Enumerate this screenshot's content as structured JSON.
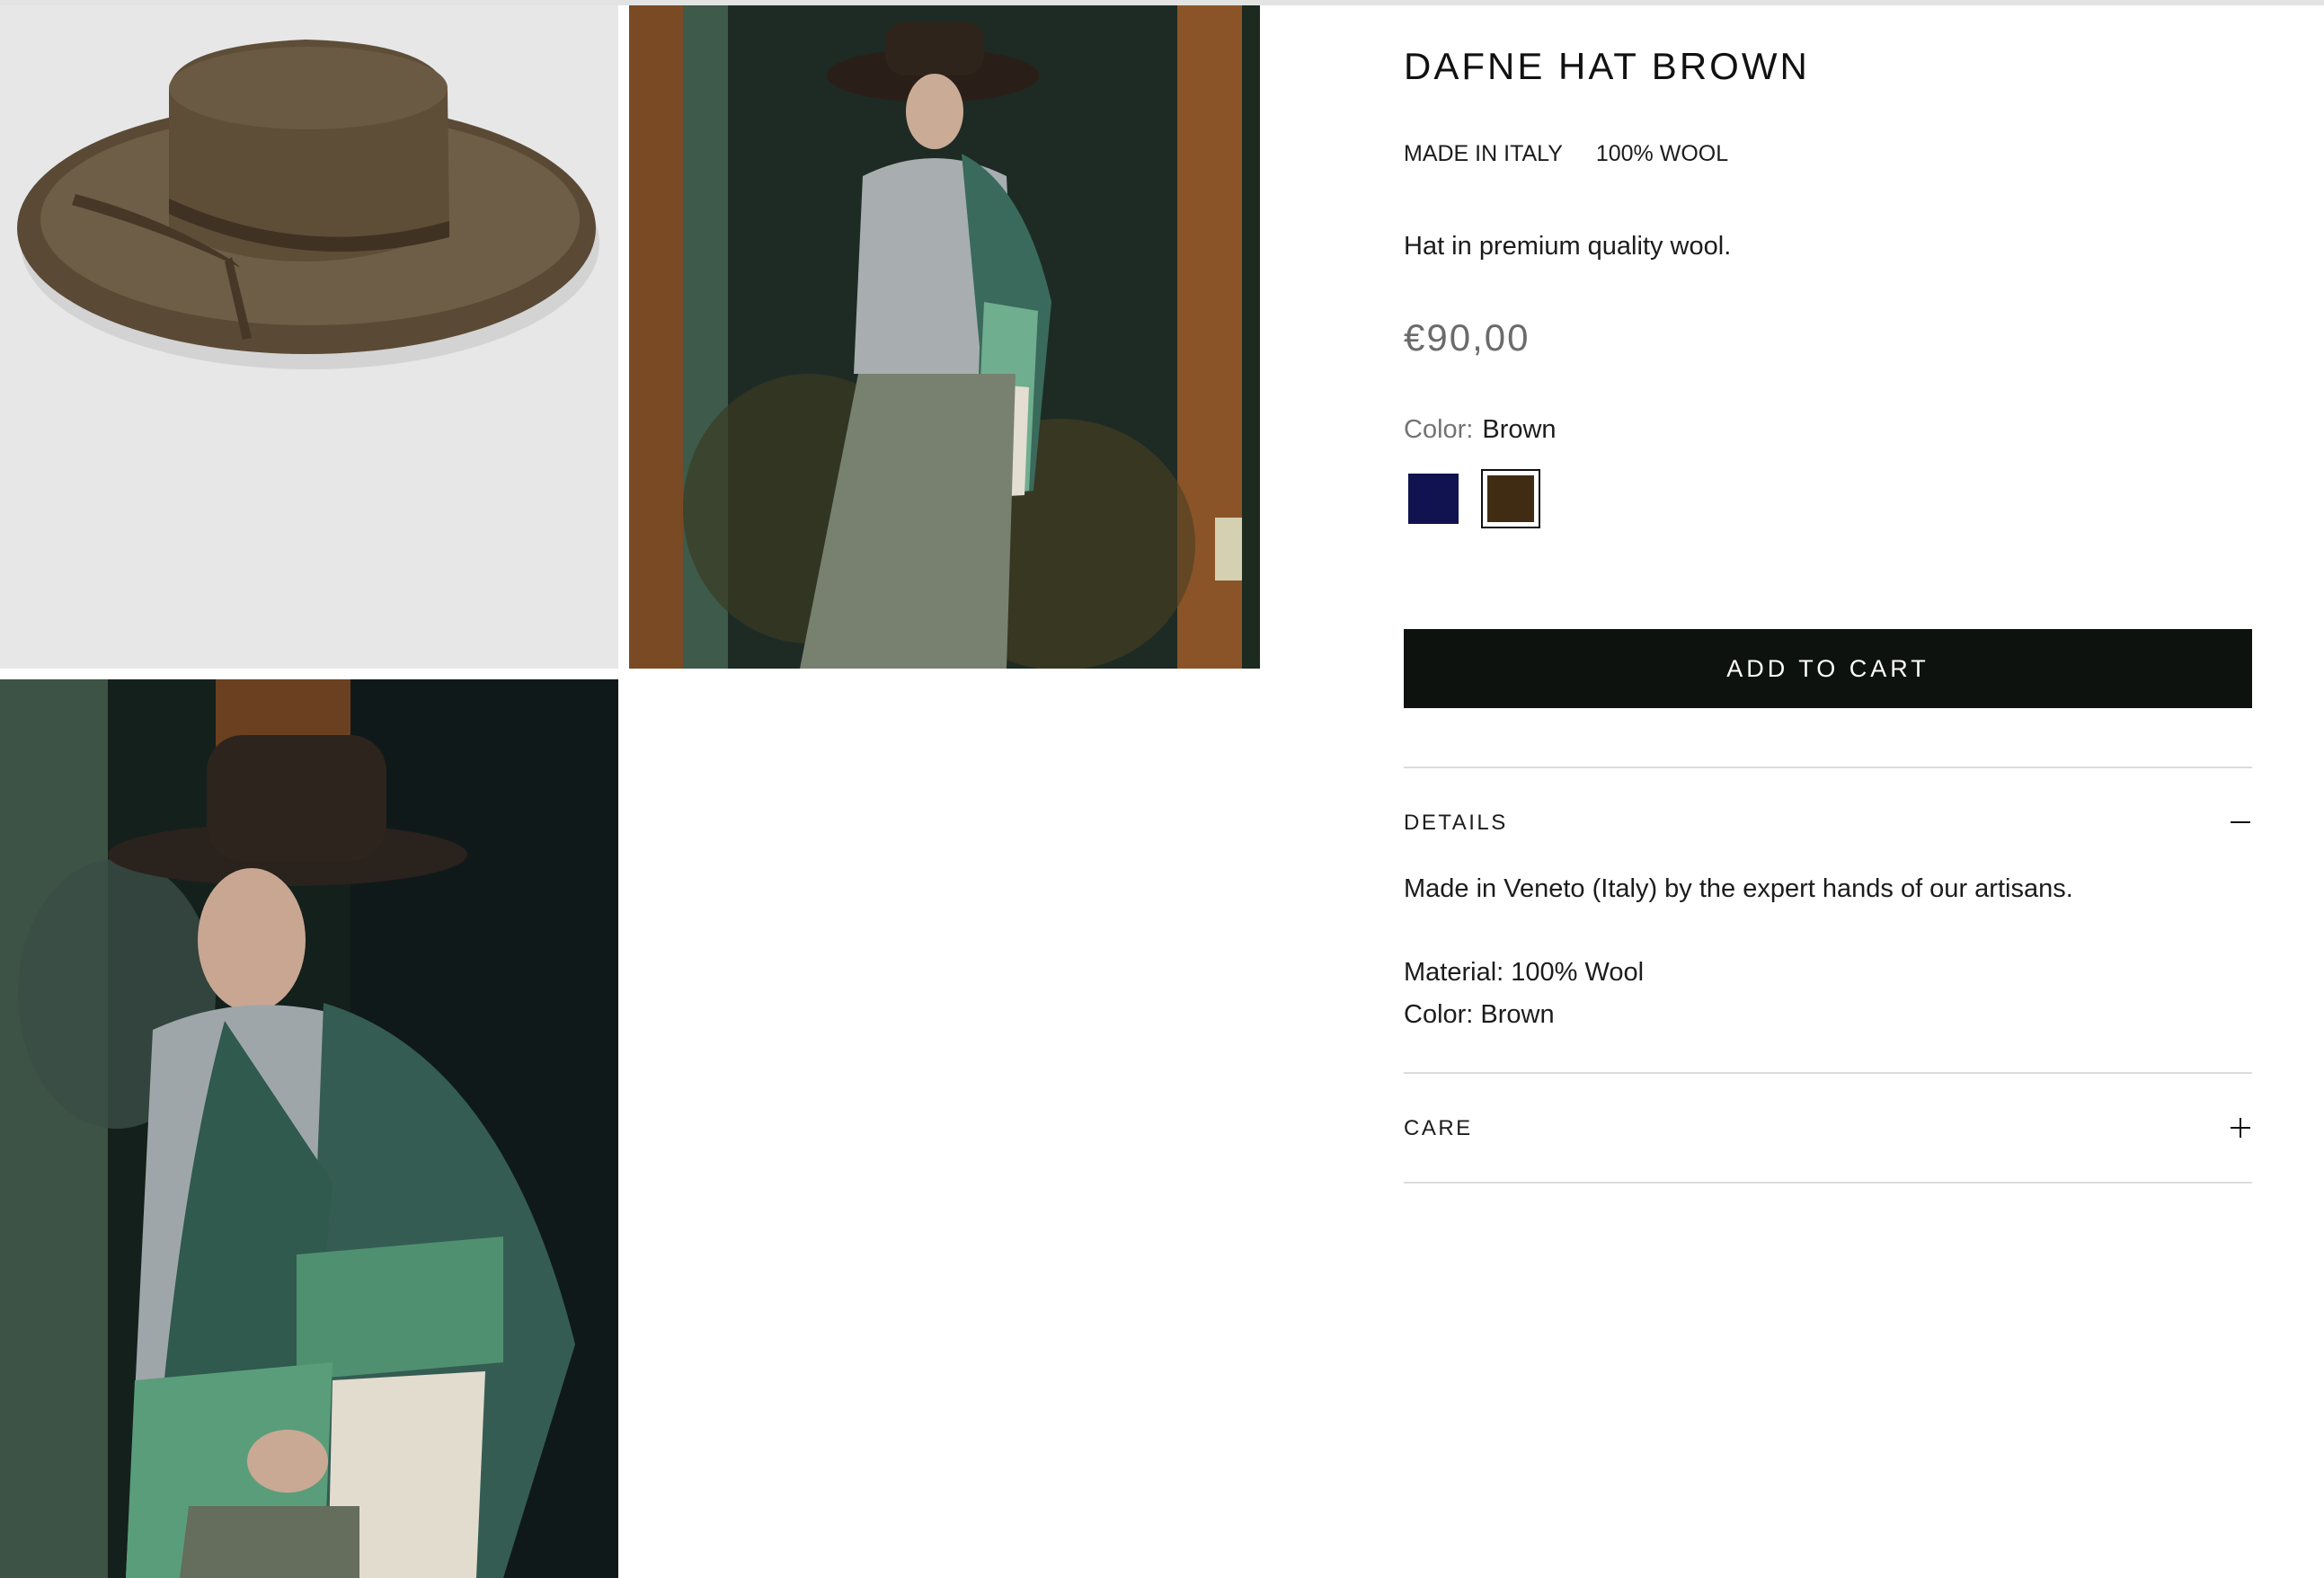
{
  "product": {
    "title": "DAFNE HAT BROWN",
    "tags": [
      "MADE IN ITALY",
      "100% WOOL"
    ],
    "description": "Hat in premium quality wool.",
    "price": "€90,00",
    "color_label": "Color:",
    "color_value": "Brown",
    "swatches": [
      {
        "name": "Navy",
        "hex": "#10134f",
        "selected": false
      },
      {
        "name": "Brown",
        "hex": "#3f2c12",
        "selected": true
      }
    ],
    "add_to_cart": "ADD TO CART"
  },
  "accordion": {
    "details": {
      "title": "DETAILS",
      "expanded": true,
      "intro": "Made in Veneto (Italy) by the expert hands of our artisans.",
      "material": "Material: 100% Wool",
      "color": "Color: Brown"
    },
    "care": {
      "title": "CARE",
      "expanded": false
    }
  },
  "gallery": [
    {
      "subject": "brown wool hat on grey background"
    },
    {
      "subject": "model wearing hat and green wool scarf by window"
    },
    {
      "subject": "model in profile wearing hat and green wool scarf"
    }
  ],
  "colors": {
    "button_bg": "#0e120e",
    "price_text": "#6b6b6b",
    "divider": "#dcdcdc"
  }
}
